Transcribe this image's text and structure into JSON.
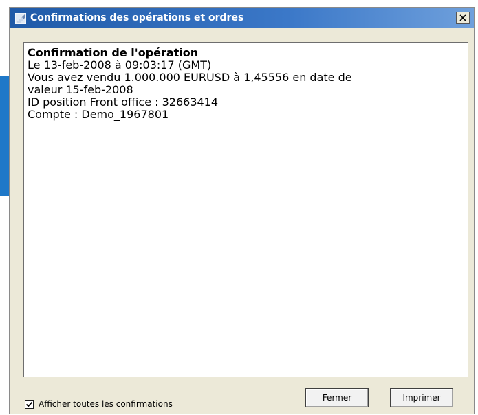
{
  "window": {
    "title": "Confirmations des opérations et ordres",
    "close_symbol": "×",
    "titlebar_color": "#1f5aa8"
  },
  "confirmation": {
    "heading": "Confirmation de l'opération",
    "lines": [
      "Le 13-feb-2008 à 09:03:17 (GMT)",
      "Vous avez vendu 1.000.000 EURUSD à 1,45556 en date de",
      "valeur 15-feb-2008",
      "ID position Front office : 32663414",
      "Compte : Demo_1967801"
    ]
  },
  "footer": {
    "checkbox_label": "Afficher toutes les confirmations",
    "checkbox_checked": true,
    "close_button_label": "Fermer",
    "print_button_label": "Imprimer"
  },
  "icons": {
    "app": "app-logo-icon",
    "close": "close-icon",
    "check": "checkmark-icon"
  }
}
